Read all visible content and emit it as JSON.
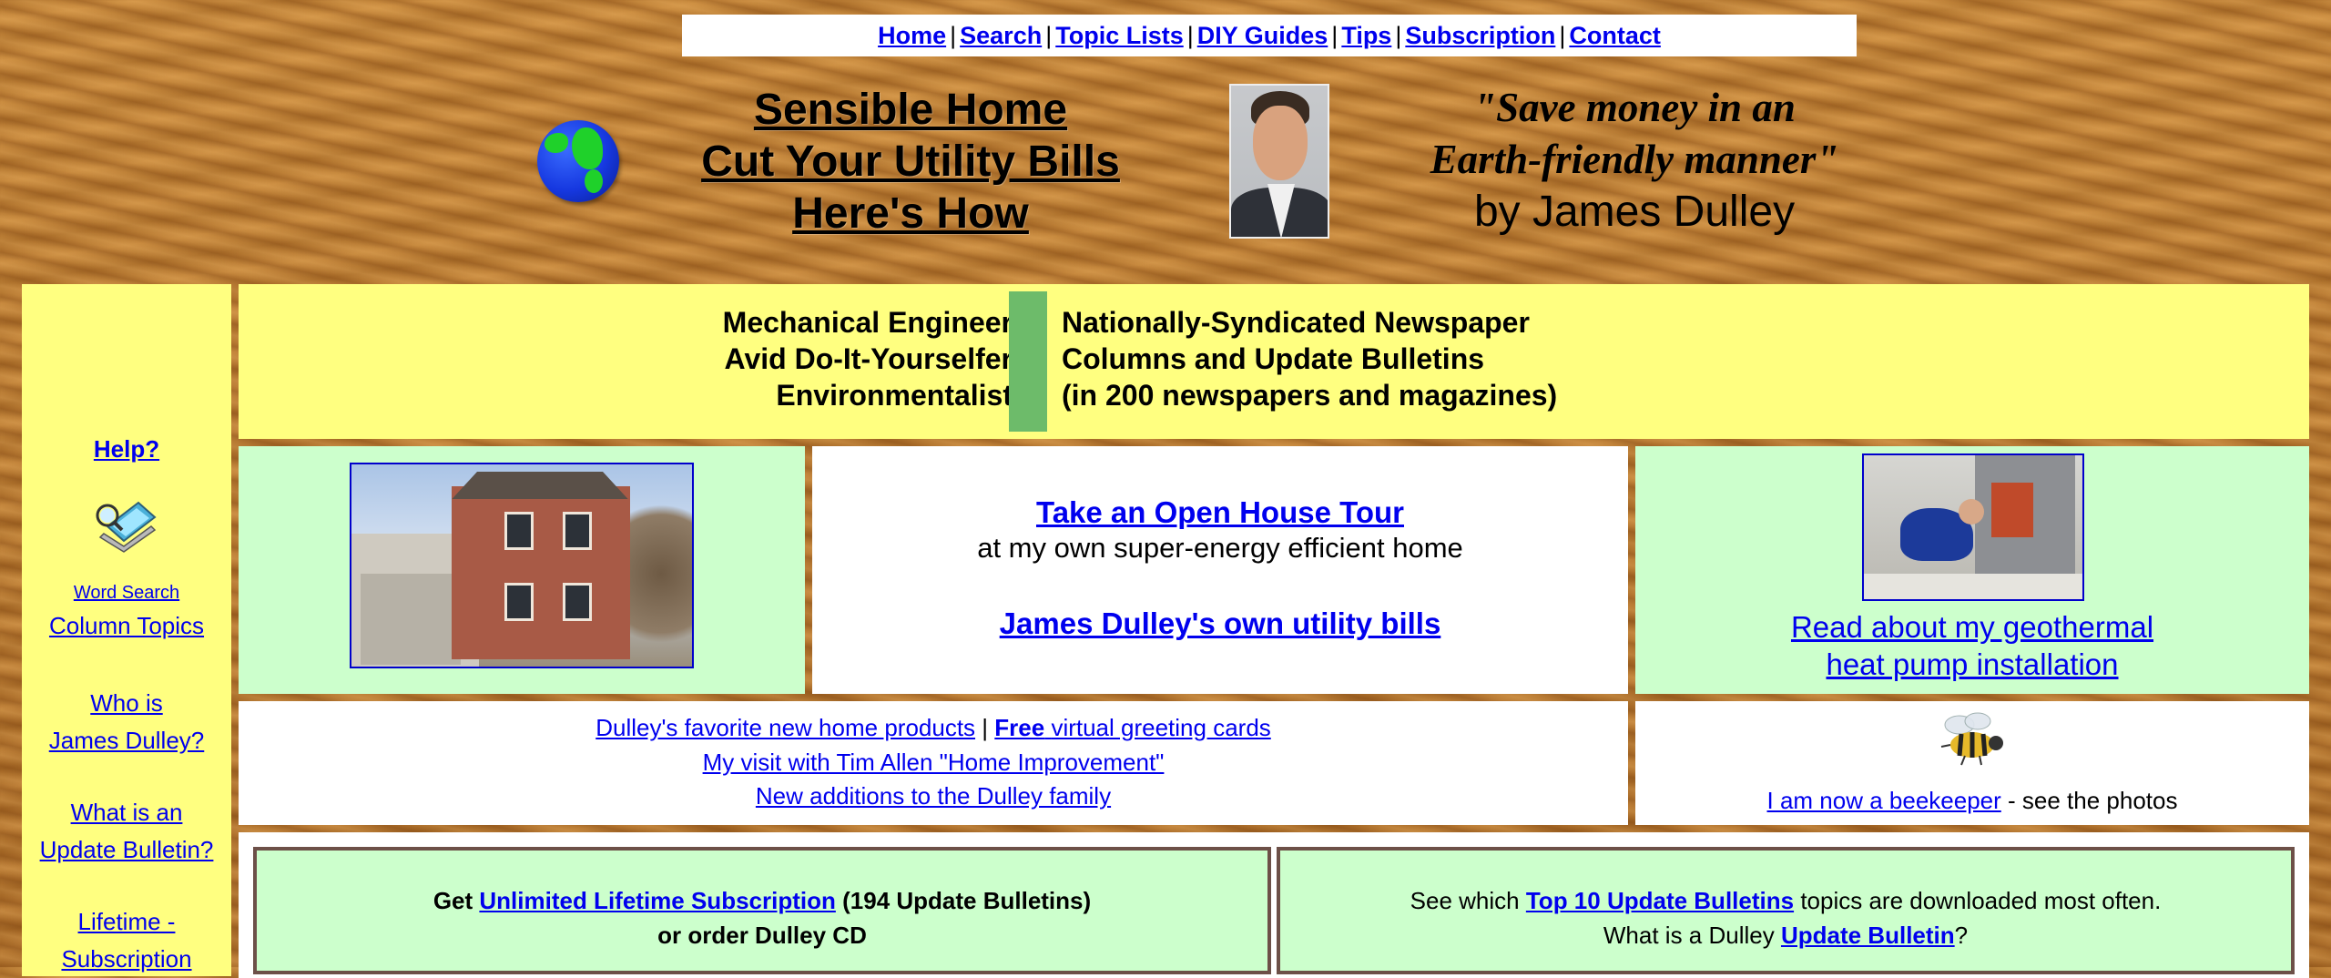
{
  "nav": {
    "items": [
      "Home",
      "Search",
      "Topic Lists",
      "DIY Guides",
      "Tips",
      "Subscription",
      "Contact"
    ],
    "separator": "|"
  },
  "header": {
    "title_lines": [
      "Sensible Home",
      "Cut Your Utility Bills",
      "Here's How"
    ],
    "quote_line1": "Save money in an",
    "quote_line2": "Earth-friendly manner",
    "quote_mark": "\"",
    "byline": "by James Dulley"
  },
  "sidebar": {
    "help": "Help?",
    "word_search": "Word Search",
    "column_topics": "Column Topics",
    "who_line1": "Who is",
    "who_line2": "James Dulley?",
    "ub_line1": "What is an",
    "ub_line2": "Update Bulletin?",
    "lifetime_line1": "Lifetime -",
    "lifetime_line2": "Subscription"
  },
  "credentials": {
    "left": [
      "Mechanical Engineer",
      "Avid Do-It-Yourselfer",
      "Environmentalist"
    ],
    "right": [
      "Nationally-Syndicated Newspaper",
      "Columns and Update Bulletins",
      "(in 200 newspapers and magazines)"
    ],
    "bar_color": "#6dbb6a"
  },
  "features": {
    "tour_link": "Take an Open House Tour",
    "tour_text": "at my own super-energy efficient home",
    "bills_link": "James Dulley's own utility bills",
    "geo_line1": "Read about my geothermal",
    "geo_line2": "heat pump installation"
  },
  "links": {
    "favorites": "Dulley's favorite new home products",
    "sep": "|",
    "free": "Free",
    "greeting": "virtual greeting cards",
    "tim_allen": "My visit with Tim Allen \"Home Improvement\"",
    "family": "New additions to the Dulley family",
    "beekeeper_link": "I am now a beekeeper",
    "beekeeper_text": "- see the photos"
  },
  "subscription": {
    "get": "Get",
    "lifetime_link": "Unlimited Lifetime Subscription",
    "count": "(194 Update Bulletins)",
    "cd": "or order Dulley CD",
    "see_which": "See which",
    "top10_link": "Top 10 Update Bulletins",
    "topics_text": "topics are downloaded most often.",
    "what_is": "What is a Dulley",
    "ub_link": "Update Bulletin",
    "qmark": "?"
  },
  "colors": {
    "panel_yellow": "#ffff80",
    "panel_green": "#ccffcc",
    "link_blue": "#0000ee"
  }
}
